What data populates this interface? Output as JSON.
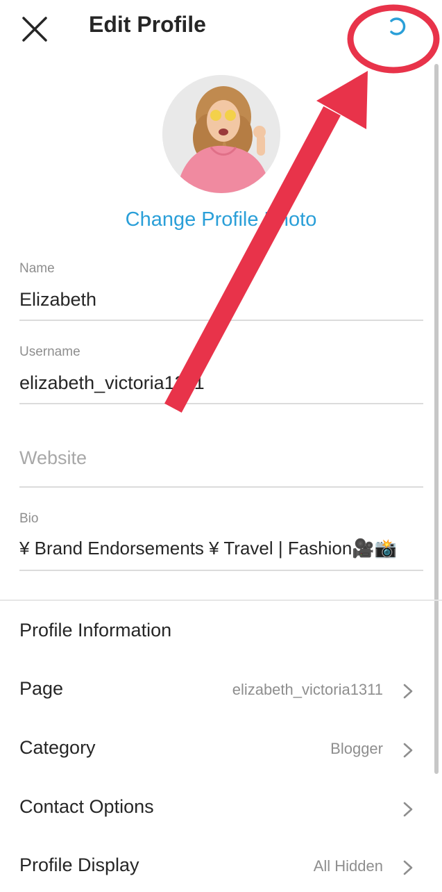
{
  "header": {
    "title": "Edit Profile",
    "close_icon": "close-icon",
    "loading_icon": "spinner-icon"
  },
  "profile": {
    "change_photo_label": "Change Profile Photo"
  },
  "fields": {
    "name": {
      "label": "Name",
      "value": "Elizabeth"
    },
    "username": {
      "label": "Username",
      "value": "elizabeth_victoria1311"
    },
    "website": {
      "placeholder": "Website",
      "value": ""
    },
    "bio": {
      "label": "Bio",
      "value": "¥ Brand Endorsements ¥ Travel | Fashion🎥📸"
    }
  },
  "profile_information": {
    "title": "Profile Information",
    "rows": [
      {
        "label": "Page",
        "value": "elizabeth_victoria1311"
      },
      {
        "label": "Category",
        "value": "Blogger"
      },
      {
        "label": "Contact Options",
        "value": ""
      },
      {
        "label": "Profile Display",
        "value": "All Hidden"
      }
    ]
  },
  "colors": {
    "link_blue": "#2a9fd8",
    "annotation_red": "#e8334a",
    "text": "#262626",
    "muted": "#8e8e8e"
  }
}
